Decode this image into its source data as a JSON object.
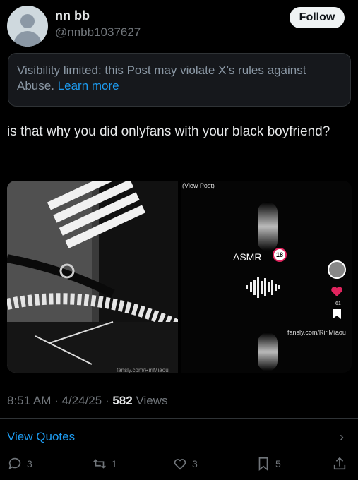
{
  "author": {
    "display_name": "nn bb",
    "handle": "@nnbb1037627"
  },
  "follow_label": "Follow",
  "notice": {
    "text": "Visibility limited: this Post may violate X’s rules against Abuse.",
    "link": "Learn more"
  },
  "post_text": "is that why you did onlyfans with your black boyfriend?",
  "media": {
    "view_post": "(View Post)",
    "asmr": "ASMR",
    "age_badge": "18",
    "like_count": "61",
    "link_text": "fansly.com/RiriMiaou",
    "photo_credit": "fansly.com/RiriMiaou"
  },
  "meta": {
    "time": "8:51 AM",
    "date": "4/24/25",
    "views_count": "582",
    "views_label": "Views"
  },
  "view_quotes": "View Quotes",
  "actions": {
    "replies": "3",
    "reposts": "1",
    "likes": "3",
    "bookmarks": "5"
  },
  "colors": {
    "accent": "#1d9bf0",
    "background": "#000000",
    "secondary_text": "#71767b"
  }
}
